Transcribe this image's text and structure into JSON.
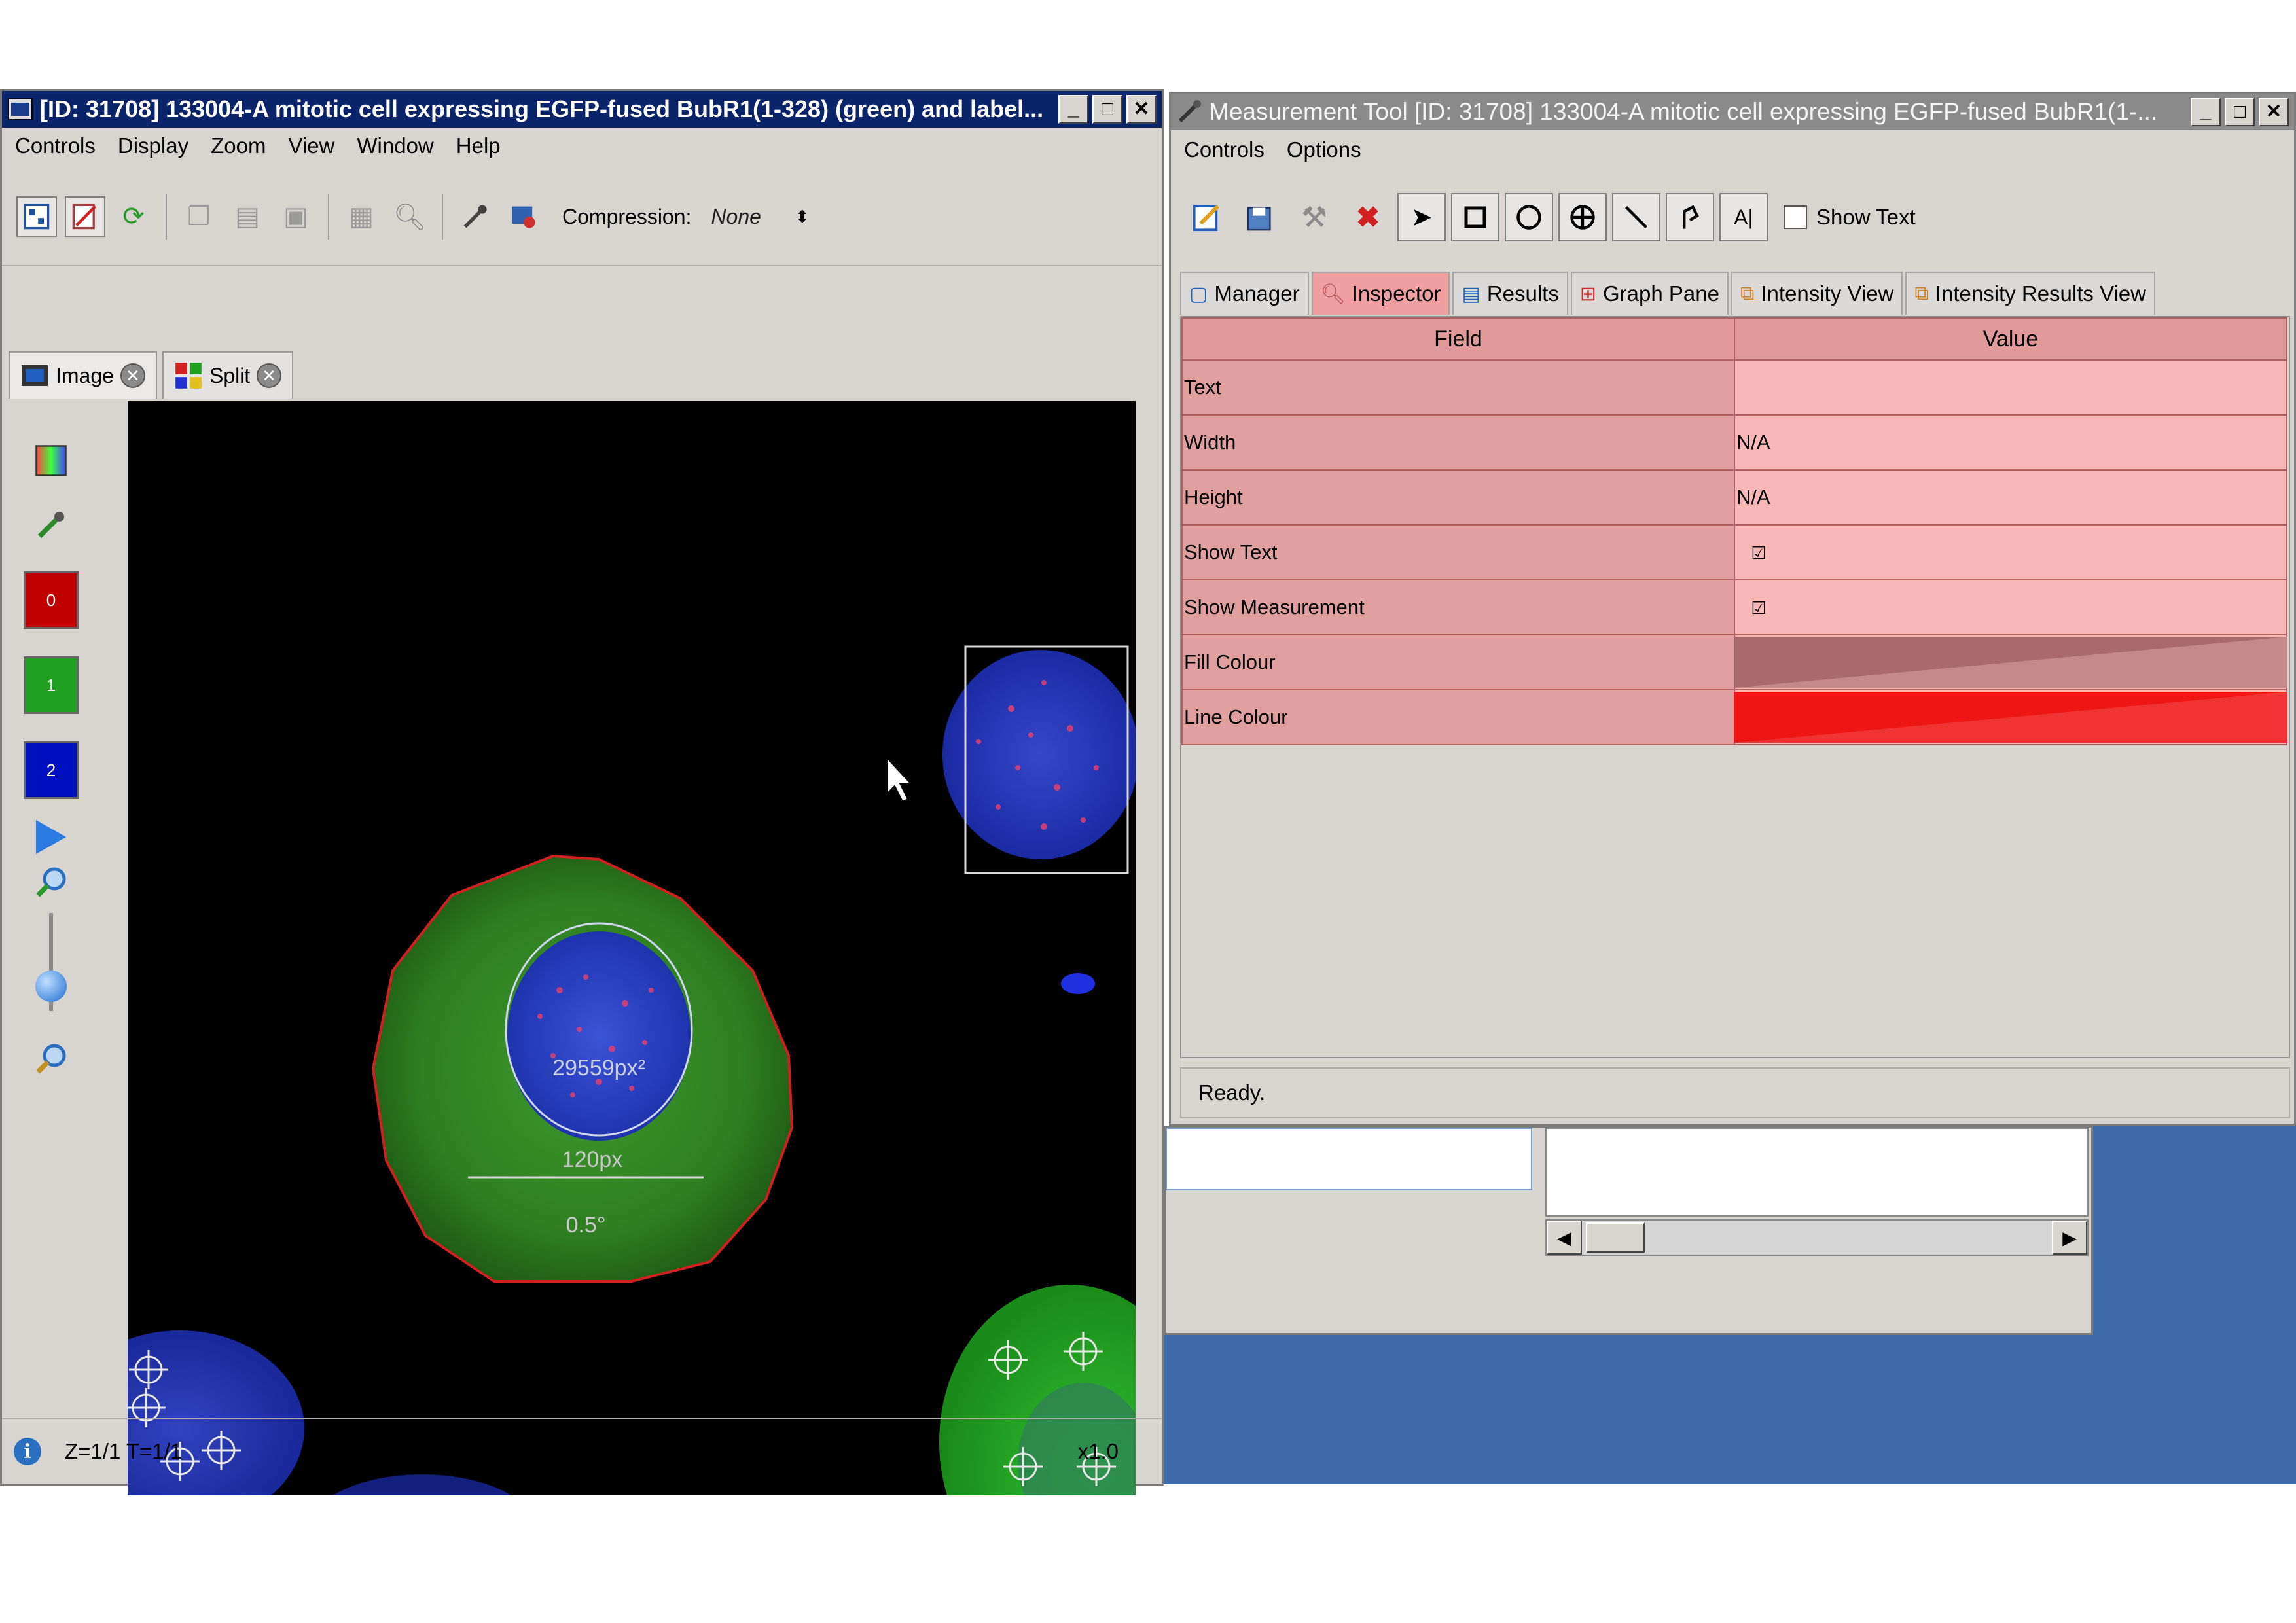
{
  "viewer": {
    "title": "[ID: 31708] 133004-A mitotic cell expressing EGFP-fused BubR1(1-328) (green) and label...",
    "menu": [
      "Controls",
      "Display",
      "Zoom",
      "View",
      "Window",
      "Help"
    ],
    "toolbar": {
      "compression_label": "Compression:",
      "compression_value": "None"
    },
    "tabs": [
      {
        "label": "Image"
      },
      {
        "label": "Split"
      }
    ],
    "channels": [
      "0",
      "1",
      "2"
    ],
    "overlays": {
      "area_label": "29559px²",
      "length_label": "120px",
      "angle_label": "0.5°"
    },
    "status": {
      "position": "Z=1/1 T=1/1",
      "zoom": "x1.0"
    }
  },
  "mtool": {
    "title": "Measurement Tool [ID: 31708] 133004-A mitotic cell expressing EGFP-fused BubR1(1-...",
    "menu": [
      "Controls",
      "Options"
    ],
    "show_text_label": "Show Text",
    "tabs": [
      {
        "label": "Manager",
        "icon": "magnifier-icon"
      },
      {
        "label": "Inspector",
        "icon": "inspector-icon"
      },
      {
        "label": "Results",
        "icon": "results-icon"
      },
      {
        "label": "Graph Pane",
        "icon": "graph-icon"
      },
      {
        "label": "Intensity View",
        "icon": "intensity-icon"
      },
      {
        "label": "Intensity Results View",
        "icon": "intensity-results-icon"
      }
    ],
    "table": {
      "headers": [
        "Field",
        "Value"
      ],
      "rows": [
        {
          "field": "Text",
          "value": ""
        },
        {
          "field": "Width",
          "value": "N/A"
        },
        {
          "field": "Height",
          "value": "N/A"
        },
        {
          "field": "Show Text",
          "value": "☑"
        },
        {
          "field": "Show Measurement",
          "value": "☑"
        },
        {
          "field": "Fill Colour",
          "value": ""
        },
        {
          "field": "Line Colour",
          "value": ""
        }
      ],
      "fill_colour": "#a86a6a",
      "line_colour": "#ee1515"
    },
    "status": "Ready."
  },
  "colors": {
    "viewer_title_bg": "#0a246a",
    "inactive_title_bg": "#8a8a8a",
    "desktop": "#3e6aa7",
    "channel_red": "#c00000",
    "channel_green": "#20a020",
    "channel_blue": "#0010c0"
  }
}
